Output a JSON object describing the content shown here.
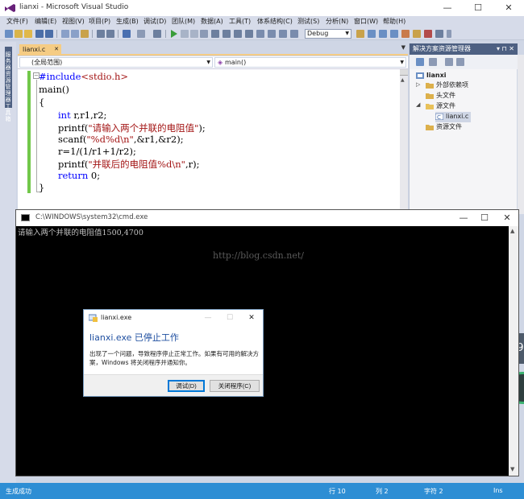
{
  "vs": {
    "title": "lianxi - Microsoft Visual Studio",
    "window_buttons": [
      "—",
      "☐",
      "✕"
    ],
    "menu": [
      "文件(F)",
      "编辑(E)",
      "视图(V)",
      "项目(P)",
      "生成(B)",
      "调试(D)",
      "团队(M)",
      "数据(A)",
      "工具(T)",
      "体系结构(C)",
      "测试(S)",
      "分析(N)",
      "窗口(W)",
      "帮助(H)"
    ],
    "config": "Debug",
    "left_strip_label": "服务器资源管理器工具箱",
    "editor_tab": "lianxi.c",
    "scope_dropdown": "(全局范围)",
    "function_dropdown": "main()",
    "code": {
      "line1_pp": "#include",
      "line1_inc": "<stdio.h>",
      "line2": "main()",
      "line3": "{",
      "line4_kw": "int",
      "line4_rest": " r,r1,r2;",
      "line5_pre": "printf(",
      "line5_str": "\"请输入两个并联的电阻值\"",
      "line5_post": ");",
      "line6_pre": "scanf(",
      "line6_str": "\"%d%d\\n\"",
      "line6_post": ",&r1,&r2);",
      "line7": "r=1/(1/r1+1/r2);",
      "line8_pre": "printf(",
      "line8_str": "\"并联后的电阻值%d\\n\"",
      "line8_post": ",r);",
      "line9_kw": "return",
      "line9_rest": " 0;",
      "line10": "}"
    }
  },
  "solution": {
    "header": "解决方案资源管理器",
    "header_buttons": "▾ ⊓ ✕",
    "tree": {
      "project": "lianxi",
      "external": "外部依赖项",
      "headers": "头文件",
      "sources": "源文件",
      "source_file": "lianxi.c",
      "resources": "资源文件"
    }
  },
  "cmd": {
    "title": "C:\\WINDOWS\\system32\\cmd.exe",
    "output": "请输入两个并联的电阻值1500,4700",
    "watermark": "http://blog.csdn.net/",
    "window_buttons": [
      "—",
      "☐",
      "✕"
    ]
  },
  "dialog": {
    "title": "lianxi.exe",
    "heading": "lianxi.exe 已停止工作",
    "message": "出现了一个问题，导致程序停止正常工作。如果有可用的解决方案，Windows 将关闭程序并通知你。",
    "debug_label": "调试(D)",
    "close_label": "关闭程序(C)",
    "buttons": [
      "—",
      "☐",
      "✕"
    ]
  },
  "status": {
    "message": "生成成功",
    "line": "行 10",
    "col": "列 2",
    "char": "字符 2",
    "mode": "Ins"
  },
  "desktop": {
    "bubble_text": "39"
  },
  "colors": {
    "accent": "#2e8ed4",
    "tab_active": "#f5cc84",
    "panel_header": "#4d6082",
    "keyword": "#0000ff",
    "string": "#a31515",
    "dialog_heading": "#1f4fa0"
  }
}
